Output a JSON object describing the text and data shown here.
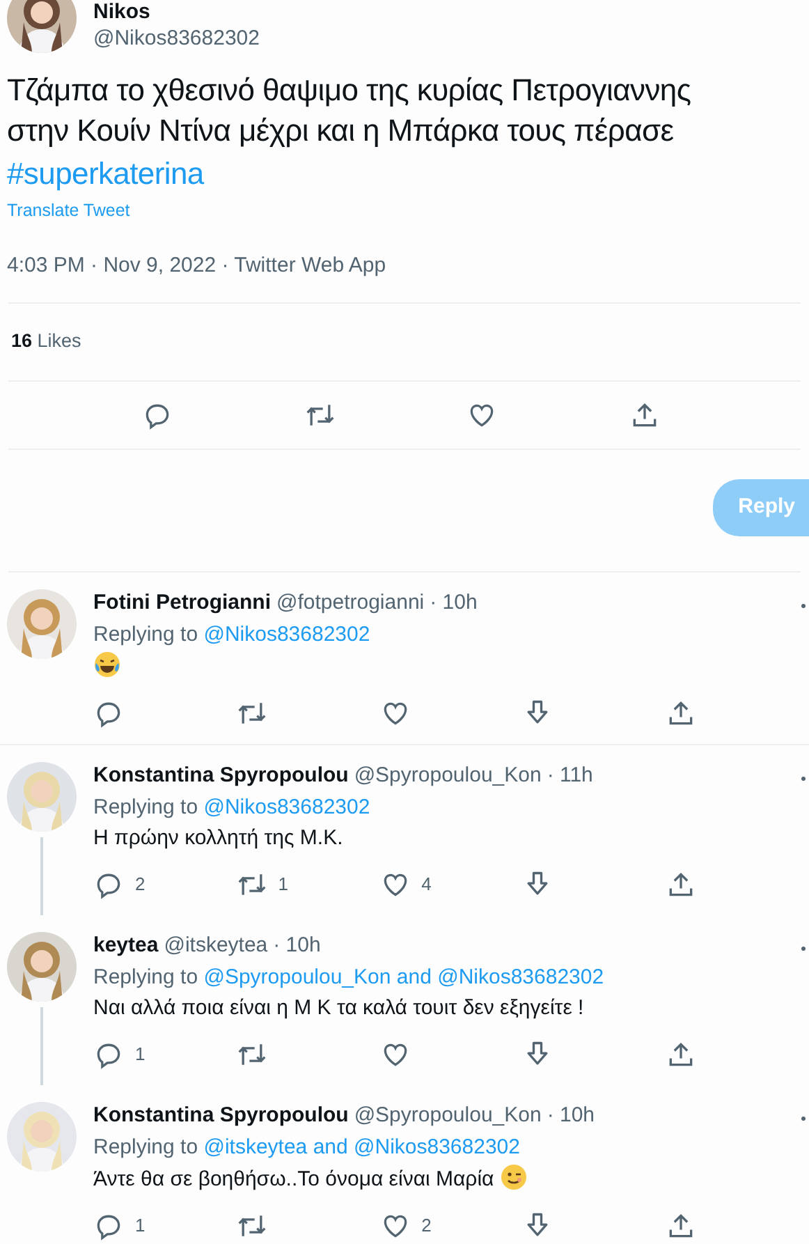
{
  "tweet": {
    "name": "Nikos",
    "handle": "@Nikos83682302",
    "text": [
      "Τζάμπα το  χθεσινό θαψιμο της κυρίας Πετρογιαννης στην Κουίν Ντίνα μέχρι και η Μπάρκα τους πέρασε"
    ],
    "hashtag": "#superkaterina",
    "translate": "Translate Tweet",
    "meta": "4:03 PM · Nov 9, 2022 · Twitter Web App",
    "likes_count": "16",
    "likes_label": "Likes",
    "reply_button": "Reply"
  },
  "replies": [
    {
      "name": "Fotini Petrogianni",
      "handle": "@fotpetrogianni",
      "time": "· 10h",
      "replying_label": "Replying to",
      "replying_to": [
        "@Nikos83682302"
      ],
      "laughing_emoji": true,
      "thread_line": false
    },
    {
      "name": "Konstantina Spyropoulou",
      "handle": "@Spyropoulou_Kon",
      "time": "· 11h",
      "replying_label": "Replying to",
      "replying_to": [
        "@Nikos83682302"
      ],
      "text": "Η πρώην κολλητή της Μ.Κ.",
      "thread_line": true,
      "counts": {
        "reply": "2",
        "retweet": "1",
        "like": "4"
      }
    },
    {
      "name": "keytea",
      "handle": "@itskeytea",
      "time": "· 10h",
      "replying_label": "Replying to",
      "replying_to": [
        "@Spyropoulou_Kon",
        "and",
        "@Nikos83682302"
      ],
      "text": "Ναι αλλά ποια είναι η Μ Κ τα καλά τουιτ δεν εξηγείτε !",
      "thread_line": true,
      "counts": {
        "reply": "1"
      }
    },
    {
      "name": "Konstantina Spyropoulou",
      "handle": "@Spyropoulou_Kon",
      "time": "· 10h",
      "replying_label": "Replying to",
      "replying_to": [
        "@itskeytea",
        "and",
        "@Nikos83682302"
      ],
      "text": "Άντε θα σε βοηθήσω..Το όνομα είναι Μαρία",
      "winking_emoji": true,
      "thread_line": false,
      "counts": {
        "reply": "1",
        "like": "2"
      }
    }
  ]
}
